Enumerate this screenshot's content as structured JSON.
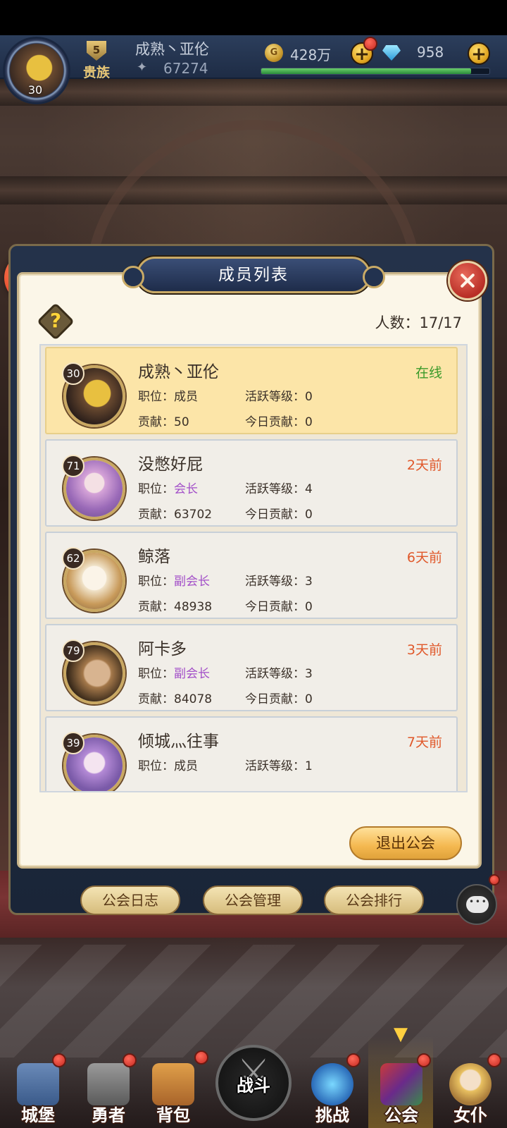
{
  "player": {
    "name": "成熟丶亚伦",
    "level": "30",
    "vip_level": "5",
    "vip_label": "贵族",
    "power": "67274",
    "exp_fraction": 0.92
  },
  "currency": {
    "gold": "428万",
    "gems": "958"
  },
  "panel": {
    "title": "成员列表",
    "member_count": "人数：17/17",
    "quit_label": "退出公会"
  },
  "members": [
    {
      "level": "30",
      "name": "成熟丶亚伦",
      "status": "在线",
      "status_color": "#3a9a2a",
      "position_label": "职位：",
      "position": "成员",
      "activity": "活跃等级：0",
      "contribution": "贡献：50",
      "today": "今日贡献：0"
    },
    {
      "level": "71",
      "name": "没憋好屁",
      "status": "2天前",
      "status_color": "#e0582a",
      "position_label": "职位：",
      "position": "会长",
      "activity": "活跃等级：4",
      "contribution": "贡献：63702",
      "today": "今日贡献：0"
    },
    {
      "level": "62",
      "name": "鲸落",
      "status": "6天前",
      "status_color": "#e0582a",
      "position_label": "职位：",
      "position": "副会长",
      "activity": "活跃等级：3",
      "contribution": "贡献：48938",
      "today": "今日贡献：0"
    },
    {
      "level": "79",
      "name": "阿卡多",
      "status": "3天前",
      "status_color": "#e0582a",
      "position_label": "职位：",
      "position": "副会长",
      "activity": "活跃等级：3",
      "contribution": "贡献：84078",
      "today": "今日贡献：0"
    },
    {
      "level": "39",
      "name": "倾城灬往事",
      "status": "7天前",
      "status_color": "#e0582a",
      "position_label": "职位：",
      "position": "成员",
      "activity": "活跃等级：1",
      "contribution": "",
      "today": ""
    }
  ],
  "guild_tabs": [
    "公会日志",
    "公会管理",
    "公会排行"
  ],
  "nav": {
    "items": [
      "城堡",
      "勇者",
      "背包",
      "战斗",
      "挑战",
      "公会",
      "女仆"
    ],
    "active": "公会"
  },
  "colors": {
    "accent_gold": "#e6c676",
    "officer_purple": "#a24ec8",
    "self_row": "#fce5a8"
  }
}
